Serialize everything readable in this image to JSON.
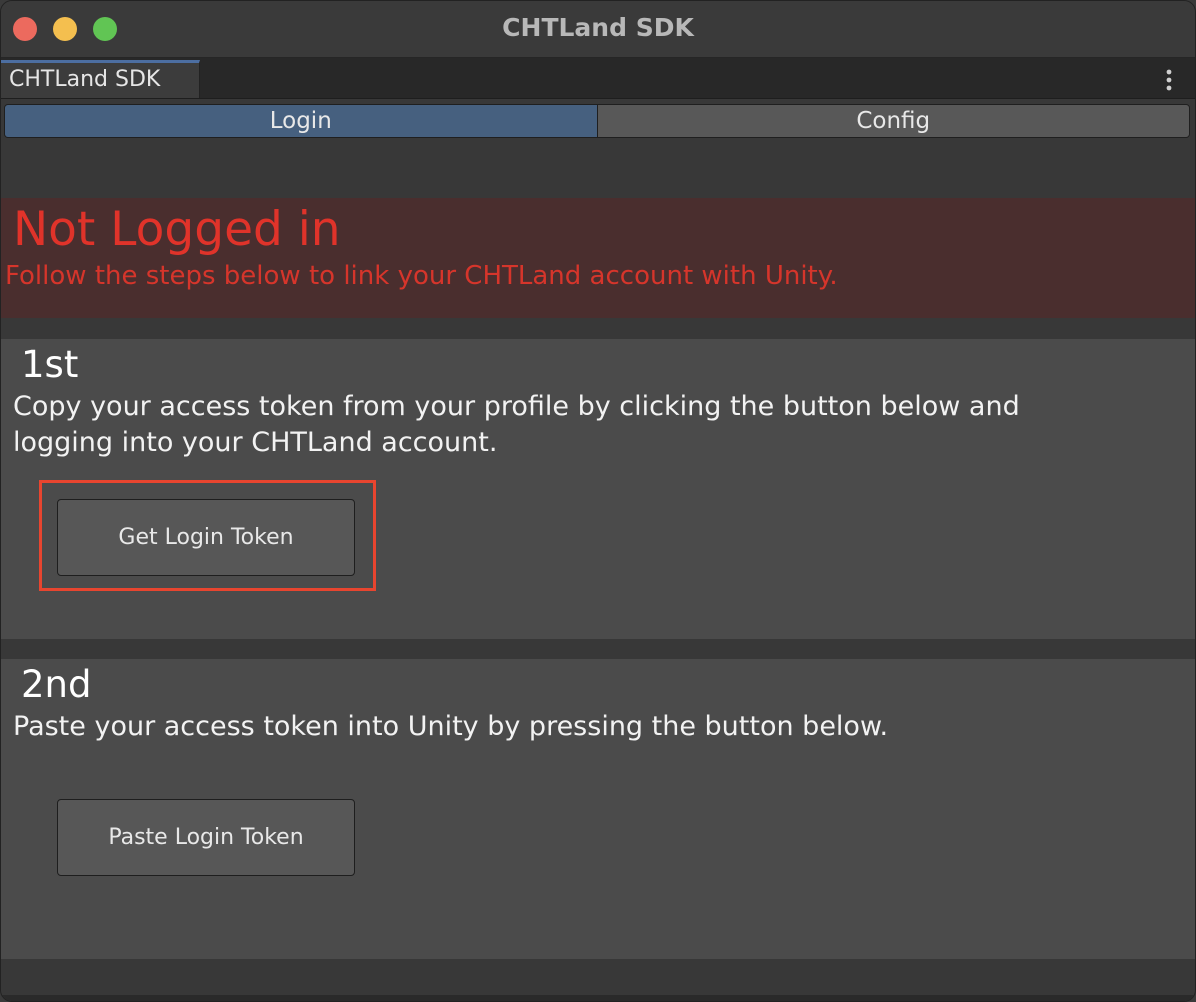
{
  "window": {
    "title": "CHTLand SDK",
    "traffic_lights": [
      "close",
      "minimize",
      "maximize"
    ],
    "colors": {
      "close": "#ec6a5e",
      "minimize": "#f4bf4f",
      "maximize": "#61c554"
    }
  },
  "window_tab": {
    "label": "CHTLand SDK",
    "more_icon": "more-vertical-icon"
  },
  "tabs": [
    {
      "label": "Login",
      "active": true
    },
    {
      "label": "Config",
      "active": false
    }
  ],
  "status": {
    "title": "Not Logged in",
    "subtitle": "Follow the steps below to link your CHTLand account with Unity.",
    "color": "#e0332a"
  },
  "steps": [
    {
      "heading": "1st",
      "text": "Copy your access token from your profile by clicking the button below and logging into your CHTLand account.",
      "button_label": "Get Login Token",
      "highlighted": true
    },
    {
      "heading": "2nd",
      "text": "Paste your access token into Unity by pressing the button below.",
      "button_label": "Paste Login Token",
      "highlighted": false
    }
  ],
  "highlight_color": "#e8452f"
}
